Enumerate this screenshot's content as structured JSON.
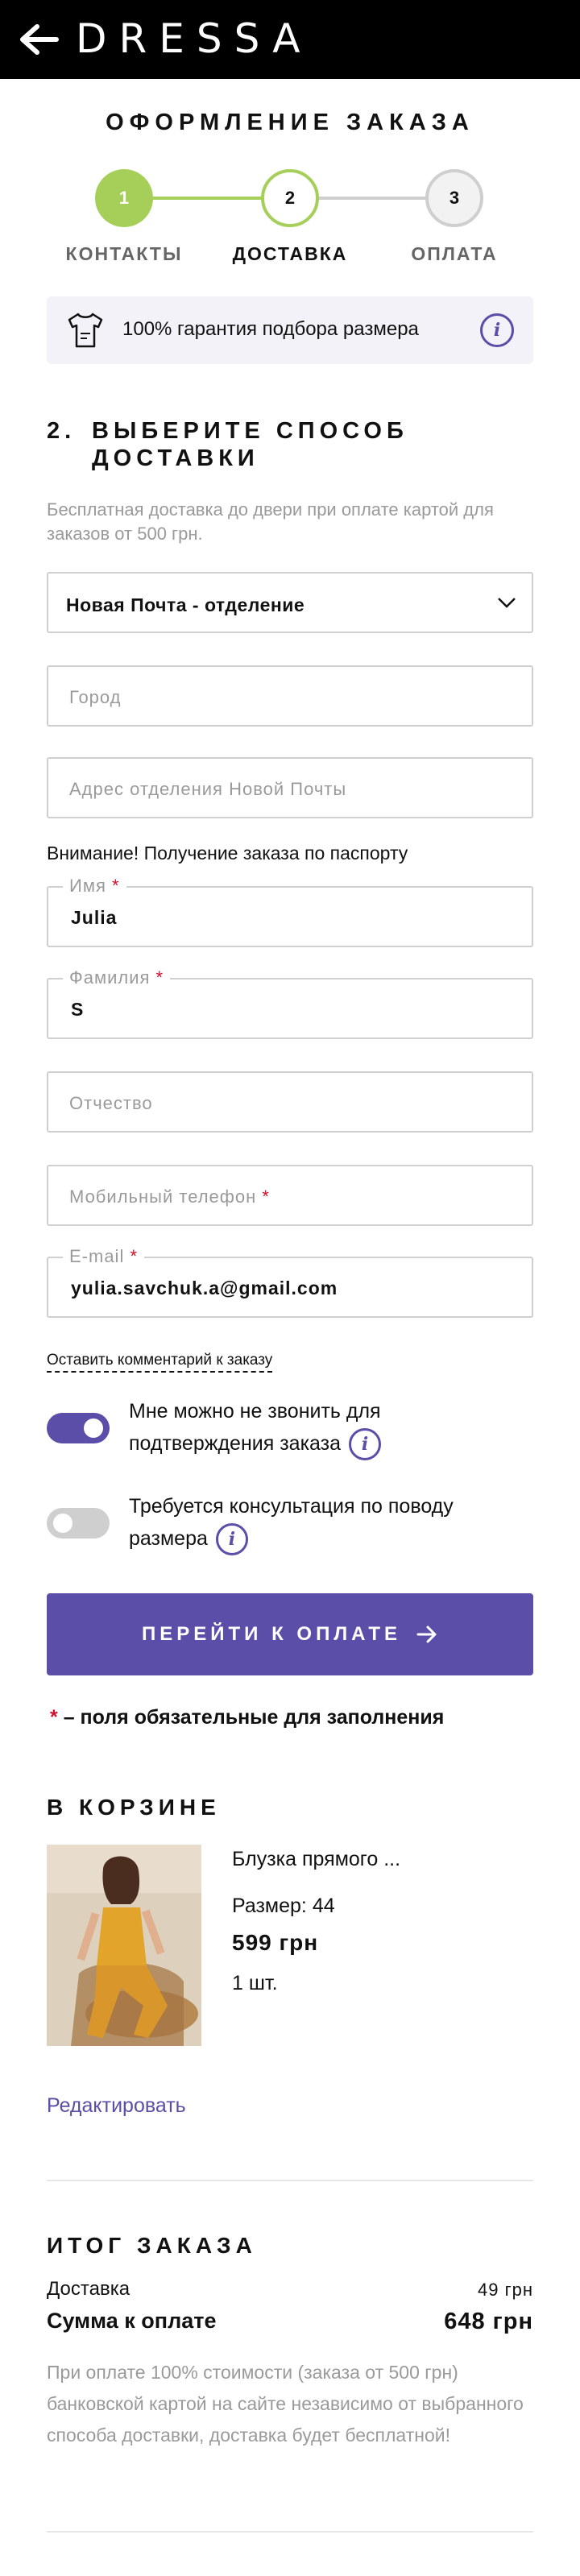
{
  "header": {
    "brand": "DRESSA"
  },
  "page_title": "ОФОРМЛЕНИЕ ЗАКАЗА",
  "stepper": {
    "steps": [
      {
        "number": "1",
        "label": "КОНТАКТЫ",
        "state": "done"
      },
      {
        "number": "2",
        "label": "ДОСТАВКА",
        "state": "active"
      },
      {
        "number": "3",
        "label": "ОПЛАТА",
        "state": "pending"
      }
    ]
  },
  "guarantee": {
    "text": "100% гарантия подбора размера"
  },
  "delivery": {
    "section_number": "2.",
    "title_line1": "ВЫБЕРИТЕ СПОСОБ",
    "title_line2": "ДОСТАВКИ",
    "note": "Бесплатная доставка до двери при оплате картой для заказов от 500 грн.",
    "method_selected": "Новая Почта - отделение",
    "city_placeholder": "Город",
    "branch_placeholder": "Адрес отделения Новой Почты",
    "warning": "Внимание! Получение заказа по паспорту"
  },
  "form": {
    "first_name_label": "Имя",
    "first_name_value": "Julia",
    "last_name_label": "Фамилия",
    "last_name_value": "S",
    "patronymic_placeholder": "Отчество",
    "phone_placeholder": "Мобильный телефон",
    "email_label": "E-mail",
    "email_value": "yulia.savchuk.a@gmail.com",
    "required_mark": "*"
  },
  "comment_link": "Оставить комментарий к заказу",
  "toggles": {
    "no_call": {
      "line1": "Мне можно не звонить для",
      "line2": "подтверждения заказа",
      "on": true
    },
    "consult": {
      "line1": "Требуется консультация по поводу",
      "line2": "размера",
      "on": false
    }
  },
  "pay_button": "ПЕРЕЙТИ К ОПЛАТЕ",
  "required_note": "– поля обязательные для заполнения",
  "cart": {
    "title": "В КОРЗИНЕ",
    "items": [
      {
        "name": "Блузка прямого ...",
        "size": "Размер: 44",
        "price": "599 грн",
        "qty": "1 шт."
      }
    ],
    "edit_label": "Редактировать"
  },
  "summary": {
    "title": "ИТОГ ЗАКАЗА",
    "delivery_label": "Доставка",
    "delivery_value": "49 грн",
    "total_label": "Сумма к оплате",
    "total_value": "648 грн",
    "note": "При оплате 100% стоимости (заказа от 500 грн) банковской картой на сайте независимо от выбранного способа доставки, доставка будет бесплатной!"
  },
  "colors": {
    "accent": "#5b4ea8",
    "step_done": "#a6cf5a",
    "header_bg": "#000000",
    "required": "#d0102f"
  },
  "icons": {
    "back": "arrow-left-icon",
    "guarantee": "tshirt-icon",
    "info": "info-icon",
    "select": "chevron-down-icon",
    "pay": "arrow-right-icon"
  }
}
